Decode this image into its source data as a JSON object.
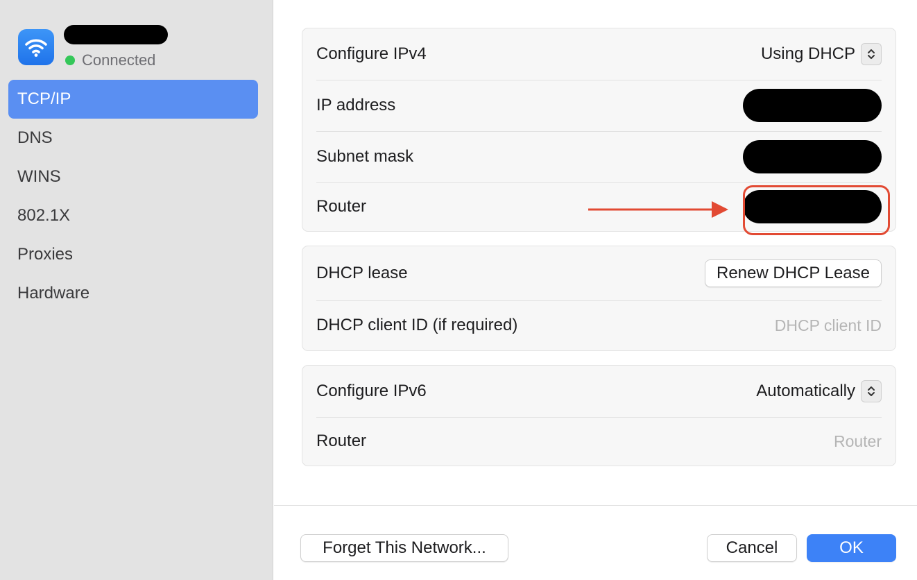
{
  "network": {
    "status": "Connected",
    "status_color": "#34c759"
  },
  "sidebar": {
    "items": [
      {
        "label": "TCP/IP",
        "active": true
      },
      {
        "label": "DNS"
      },
      {
        "label": "WINS"
      },
      {
        "label": "802.1X"
      },
      {
        "label": "Proxies"
      },
      {
        "label": "Hardware"
      }
    ]
  },
  "ipv4": {
    "configure_label": "Configure IPv4",
    "configure_value": "Using DHCP",
    "ip_label": "IP address",
    "subnet_label": "Subnet mask",
    "router_label": "Router"
  },
  "dhcp": {
    "lease_label": "DHCP lease",
    "renew_button": "Renew DHCP Lease",
    "client_id_label": "DHCP client ID (if required)",
    "client_id_placeholder": "DHCP client ID"
  },
  "ipv6": {
    "configure_label": "Configure IPv6",
    "configure_value": "Automatically",
    "router_label": "Router",
    "router_placeholder": "Router"
  },
  "footer": {
    "forget_button": "Forget This Network...",
    "cancel_button": "Cancel",
    "ok_button": "OK"
  },
  "colors": {
    "accent": "#3d82f7",
    "sidebar_selection": "#5a8ff2",
    "annotation": "#e24a33"
  },
  "icons": [
    "wifi-icon",
    "updown-chevron-icon",
    "red-arrow-annotation"
  ]
}
